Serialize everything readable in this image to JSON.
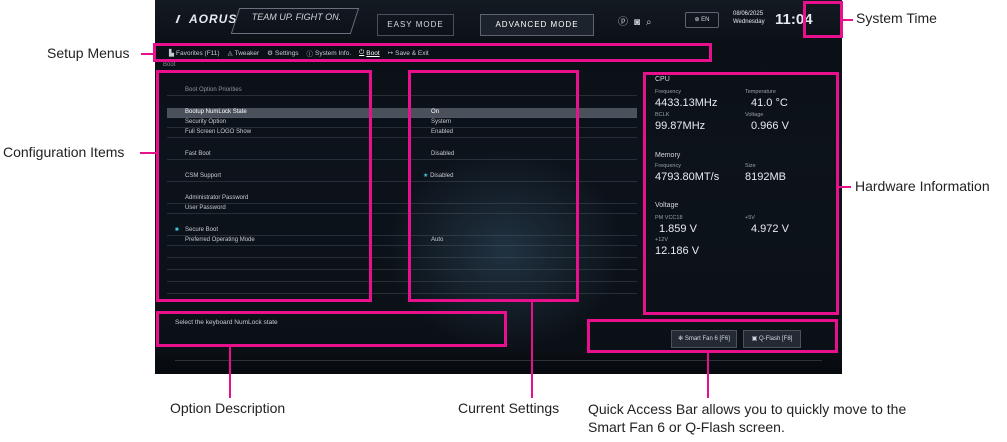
{
  "header": {
    "logo": "AORUS",
    "slogan_line1": "TEAM UP. FIGHT ON.",
    "slogan_line2": "TEAM UP. FIGHT ON.",
    "easy_mode": "EASY MODE",
    "advanced_mode": "ADVANCED MODE",
    "lang": "EN",
    "date": "08/06/2025",
    "weekday": "Wednesday",
    "time": "11:04"
  },
  "menu": {
    "favorites": "Favorites (F11)",
    "tweaker": "Tweaker",
    "settings": "Settings",
    "sysinfo": "System Info.",
    "boot": "Boot",
    "save_exit": "Save & Exit"
  },
  "breadcrumb": "Boot",
  "config": {
    "rows": [
      {
        "label": "Boot Option Priorities",
        "value": ""
      },
      {
        "label": "Bootup NumLock State",
        "value": "On"
      },
      {
        "label": "Security Option",
        "value": "System"
      },
      {
        "label": "Full Screen LOGO Show",
        "value": "Enabled"
      },
      {
        "label": "Fast Boot",
        "value": "Disabled"
      },
      {
        "label": "CSM Support",
        "value": "Disabled",
        "star": "★"
      },
      {
        "label": "Administrator Password",
        "value": ""
      },
      {
        "label": "User Password",
        "value": ""
      },
      {
        "label": "Secure Boot",
        "value": ""
      },
      {
        "label": "Preferred Operating Mode",
        "value": "Auto"
      }
    ]
  },
  "hardware": {
    "cpu_title": "CPU",
    "freq_label": "Frequency",
    "freq": "4433.13MHz",
    "temp_label": "Temperature",
    "temp": "41.0 °C",
    "bclk_label": "BCLK",
    "bclk": "99.87MHz",
    "volt_label": "Voltage",
    "volt": "0.966 V",
    "mem_title": "Memory",
    "mem_freq_label": "Frequency",
    "mem_freq": "4793.80MT/s",
    "size_label": "Size",
    "size": "8192MB",
    "voltage_title": "Voltage",
    "pmvcc_label": "PM VCC18",
    "pmvcc": "1.859 V",
    "v5_label": "+5V",
    "v5": "4.972 V",
    "v12_label": "+12V",
    "v12": "12.186 V"
  },
  "description": "Select the keyboard NumLock state",
  "quick": {
    "smartfan": "Smart Fan 6 [F6]",
    "qflash": "Q-Flash [F8]"
  },
  "callouts": {
    "system_time": "System Time",
    "setup_menus": "Setup Menus",
    "config_items": "Configuration Items",
    "hardware_info": "Hardware Information",
    "option_desc": "Option Description",
    "current_settings": "Current Settings",
    "quick_access": "Quick Access Bar allows you to quickly move to the Smart Fan 6 or Q-Flash screen."
  },
  "colors": {
    "highlight": "#e8108c"
  }
}
